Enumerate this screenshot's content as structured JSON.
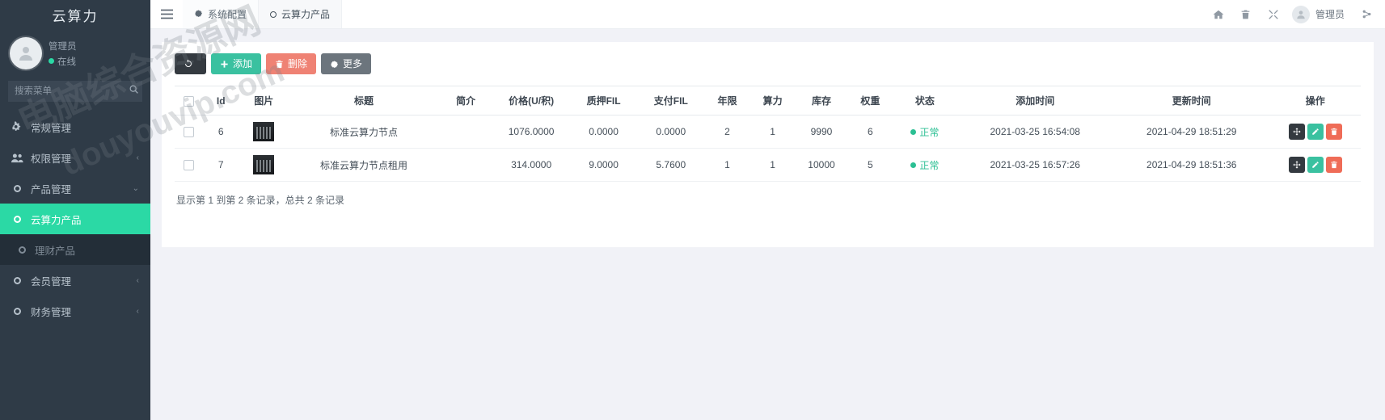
{
  "brand": {
    "title": "云算力"
  },
  "sidebar": {
    "user": {
      "name": "管理员",
      "status": "在线"
    },
    "search": {
      "placeholder": "搜索菜单",
      "icon": "search-icon"
    },
    "items": [
      {
        "label": "常规管理",
        "icon": "gears-icon",
        "caret": "",
        "state": "normal"
      },
      {
        "label": "权限管理",
        "icon": "users-icon",
        "caret": "‹",
        "state": "normal"
      },
      {
        "label": "产品管理",
        "icon": "ring-icon",
        "caret": "⌄",
        "state": "open"
      },
      {
        "label": "云算力产品",
        "icon": "ring-icon",
        "caret": "",
        "state": "active"
      },
      {
        "label": "理财产品",
        "icon": "ring-icon",
        "caret": "",
        "state": "sub"
      },
      {
        "label": "会员管理",
        "icon": "ring-icon",
        "caret": "‹",
        "state": "normal"
      },
      {
        "label": "财务管理",
        "icon": "ring-icon",
        "caret": "‹",
        "state": "normal"
      }
    ]
  },
  "topbar": {
    "menu_icon": "hamburger-icon",
    "tabs": [
      {
        "label": "系统配置",
        "icon": "gear-icon",
        "active": false
      },
      {
        "label": "云算力产品",
        "icon": "ring-icon",
        "active": true
      }
    ],
    "actions": [
      {
        "name": "home-icon"
      },
      {
        "name": "trash-icon"
      },
      {
        "name": "fullscreen-icon"
      }
    ],
    "user_label": "管理员",
    "settings_icon": "gears-icon"
  },
  "toolbar": {
    "refresh_label": "",
    "add_label": "添加",
    "delete_label": "删除",
    "more_label": "更多"
  },
  "table": {
    "columns": [
      "",
      "Id",
      "图片",
      "标题",
      "简介",
      "价格(U/积)",
      "质押FIL",
      "支付FIL",
      "年限",
      "算力",
      "库存",
      "权重",
      "状态",
      "添加时间",
      "更新时间",
      "操作"
    ],
    "rows": [
      {
        "id": "6",
        "image": "product-thumb",
        "title": "标准云算力节点",
        "summary": "",
        "price": "1076.0000",
        "pledge_fil": "0.0000",
        "pay_fil": "0.0000",
        "years": "2",
        "power": "1",
        "stock": "9990",
        "weight": "6",
        "status": "正常",
        "created_at": "2021-03-25 16:54:08",
        "updated_at": "2021-04-29 18:51:29"
      },
      {
        "id": "7",
        "image": "product-thumb",
        "title": "标准云算力节点租用",
        "summary": "",
        "price": "314.0000",
        "pledge_fil": "9.0000",
        "pay_fil": "5.7600",
        "years": "1",
        "power": "1",
        "stock": "10000",
        "weight": "5",
        "status": "正常",
        "created_at": "2021-03-25 16:57:26",
        "updated_at": "2021-04-29 18:51:36"
      }
    ],
    "footer": "显示第 1 到第 2 条记录，总共 2 条记录"
  },
  "watermark": {
    "line1": "电脑综合资源网",
    "line2": "douyouvip.com"
  },
  "colors": {
    "sidebar_bg": "#2f3b47",
    "accent_green": "#2bd9a5",
    "btn_green": "#3ac1a0",
    "btn_red": "#ef8274",
    "btn_dark": "#343a40",
    "status_green": "#2bbf93"
  }
}
